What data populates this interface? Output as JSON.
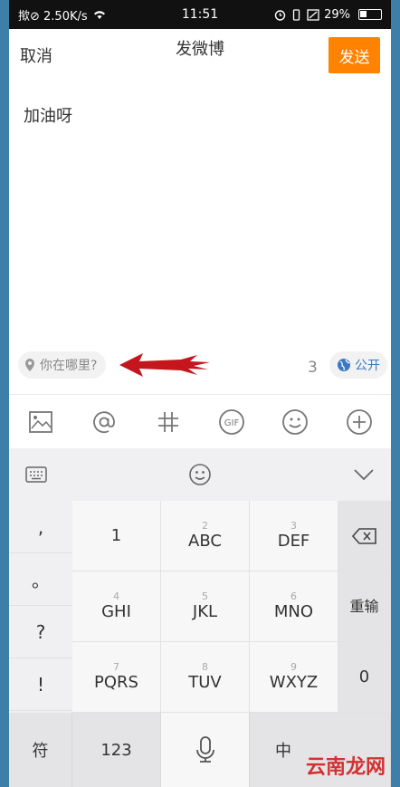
{
  "status_bar": {
    "left_text": "揿⊘ 2.50K/s",
    "time": "11:51",
    "battery": "29%"
  },
  "nav": {
    "cancel": "取消",
    "title": "发微博",
    "send": "发送"
  },
  "compose": {
    "text": "加油呀",
    "location_placeholder": "你在哪里?",
    "char_count": "3",
    "visibility": "公开"
  },
  "toolbar": {
    "icons": [
      "image-icon",
      "at-icon",
      "hashtag-icon",
      "gif-icon",
      "emoji-icon",
      "add-icon"
    ]
  },
  "keyboard": {
    "punctuation": [
      ",",
      "。",
      "?",
      "!"
    ],
    "keys": [
      {
        "num": "",
        "letters": "1"
      },
      {
        "num": "2",
        "letters": "ABC"
      },
      {
        "num": "3",
        "letters": "DEF"
      },
      {
        "num": "4",
        "letters": "GHI"
      },
      {
        "num": "5",
        "letters": "JKL"
      },
      {
        "num": "6",
        "letters": "MNO"
      },
      {
        "num": "7",
        "letters": "PQRS"
      },
      {
        "num": "8",
        "letters": "TUV"
      },
      {
        "num": "9",
        "letters": "WXYZ"
      }
    ],
    "reenter": "重输",
    "zero": "0",
    "symbols": "符",
    "numeric": "123",
    "lang": "中",
    "watermark": "云南龙网"
  },
  "colors": {
    "accent": "#ff8200",
    "link_blue": "#3b79c4",
    "arrow_red": "#c4161c"
  }
}
